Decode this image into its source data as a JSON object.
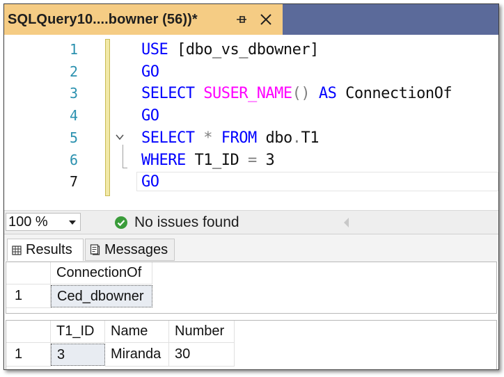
{
  "tab": {
    "title": "SQLQuery10....bowner (56))*"
  },
  "editor": {
    "line_numbers": [
      "1",
      "2",
      "3",
      "4",
      "5",
      "6",
      "7"
    ],
    "lines": [
      [
        {
          "t": "USE ",
          "c": "kw"
        },
        {
          "t": "[dbo_vs_dbowner]",
          "c": "tx"
        }
      ],
      [
        {
          "t": "GO",
          "c": "kw"
        }
      ],
      [
        {
          "t": "SELECT ",
          "c": "kw"
        },
        {
          "t": "SUSER_NAME",
          "c": "fn"
        },
        {
          "t": "() ",
          "c": "op"
        },
        {
          "t": "AS ",
          "c": "kw"
        },
        {
          "t": "ConnectionOf",
          "c": "tx"
        }
      ],
      [
        {
          "t": "GO",
          "c": "kw"
        }
      ],
      [
        {
          "t": "SELECT ",
          "c": "kw"
        },
        {
          "t": "* ",
          "c": "op"
        },
        {
          "t": "FROM ",
          "c": "kw"
        },
        {
          "t": "dbo",
          "c": "tx"
        },
        {
          "t": ".",
          "c": "op"
        },
        {
          "t": "T1",
          "c": "tx"
        }
      ],
      [
        {
          "t": "WHERE ",
          "c": "kw"
        },
        {
          "t": "T1_ID ",
          "c": "tx"
        },
        {
          "t": "= ",
          "c": "op"
        },
        {
          "t": "3",
          "c": "tx"
        }
      ],
      [
        {
          "t": "GO",
          "c": "kw"
        }
      ]
    ]
  },
  "status": {
    "zoom": "100 %",
    "message": "No issues found"
  },
  "results_tabs": {
    "results": "Results",
    "messages": "Messages"
  },
  "grid1": {
    "headers": [
      "ConnectionOf"
    ],
    "rows": [
      [
        "1",
        "Ced_dbowner"
      ]
    ]
  },
  "grid2": {
    "headers": [
      "T1_ID",
      "Name",
      "Number"
    ],
    "rows": [
      [
        "1",
        "3",
        "Miranda",
        "30"
      ]
    ]
  },
  "colors": {
    "tab_bg": "#f5cc84",
    "tabstrip_bg": "#5b6a9a",
    "keyword": "#0000ff",
    "function": "#ff00ff",
    "line_number": "#2b91af",
    "ok_green": "#3a9c3a"
  }
}
